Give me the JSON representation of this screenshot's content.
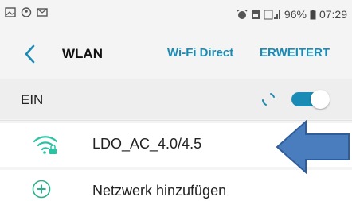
{
  "status_bar": {
    "battery": "96%",
    "time": "07:29",
    "left_icons": [
      "image-icon",
      "circle-icon",
      "mail-icon"
    ],
    "right_icons": [
      "alarm-icon",
      "sim-icon",
      "signal-icon",
      "battery-icon"
    ]
  },
  "header": {
    "title": "WLAN",
    "wifi_direct": "Wi-Fi Direct",
    "erweitert": "ERWEITERT"
  },
  "wlan_switch": {
    "label": "EIN",
    "state": "on"
  },
  "networks": [
    {
      "name": "LDO_AC_4.0/4.5",
      "icon": "wifi-locked-icon"
    }
  ],
  "add_network": {
    "label": "Netzwerk hinzufügen",
    "icon": "plus-icon"
  },
  "annotation": {
    "icon": "arrow-left-icon",
    "color": "#4a7dbd"
  },
  "colors": {
    "accent": "#1a8bb4",
    "wifi_icon": "#2ac4a4",
    "add_icon": "#2ab08a"
  }
}
